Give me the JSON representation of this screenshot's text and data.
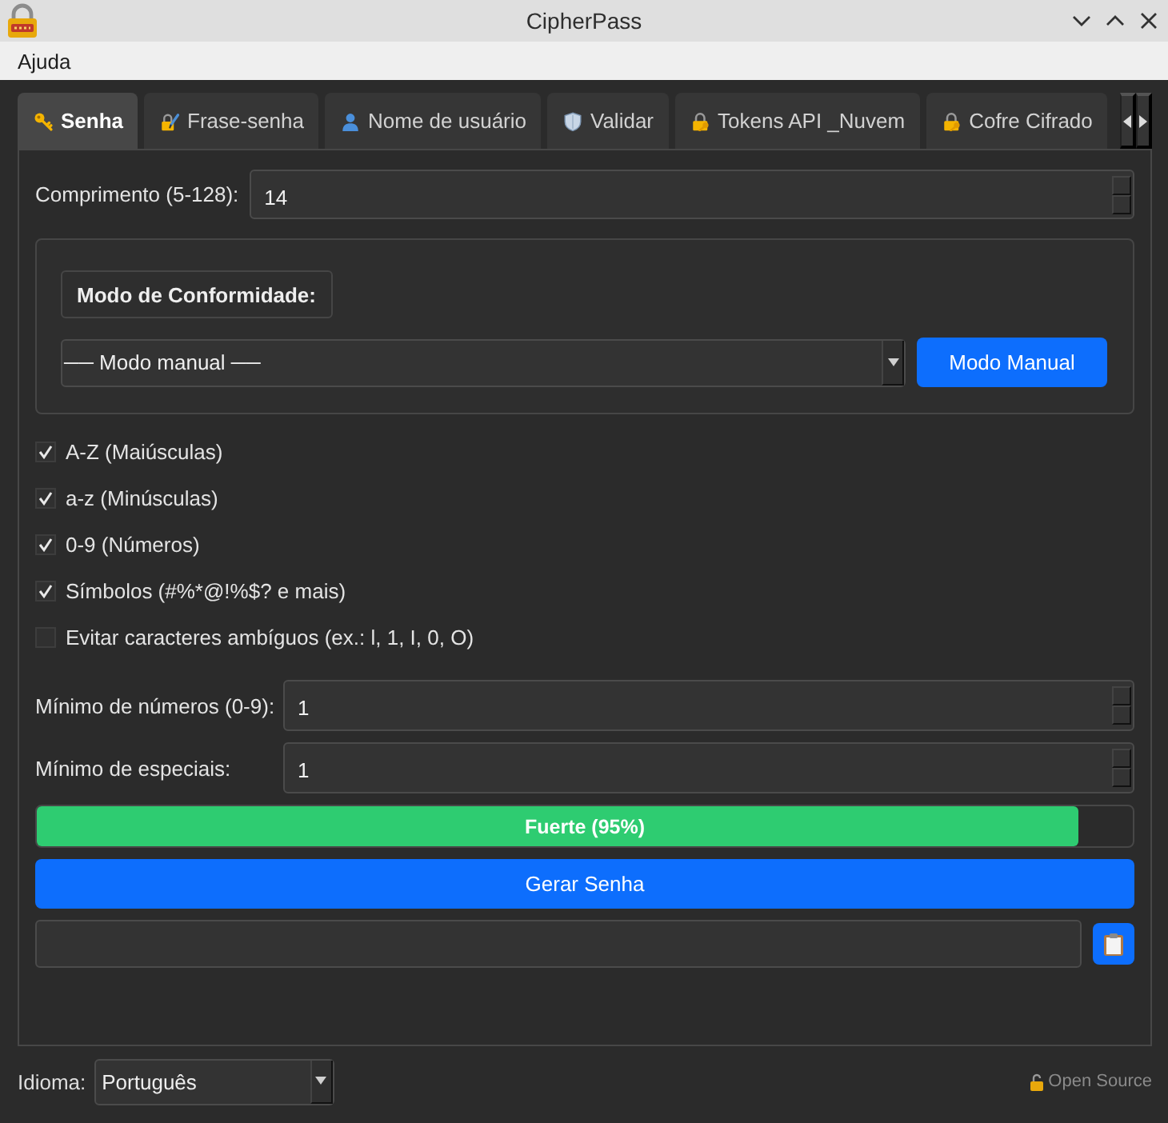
{
  "window": {
    "title": "CipherPass"
  },
  "menu": [
    "Ajuda"
  ],
  "tabs": [
    {
      "label": "Senha",
      "kind": "key",
      "selected": true
    },
    {
      "label": "Frase-senha",
      "kind": "lockpen",
      "selected": false
    },
    {
      "label": "Nome de usuário",
      "kind": "user",
      "selected": false
    },
    {
      "label": "Validar",
      "kind": "shield",
      "selected": false
    },
    {
      "label": "Tokens API _Nuvem",
      "kind": "lockkey",
      "selected": false
    },
    {
      "label": "Cofre Cifrado",
      "kind": "lockkey",
      "selected": false
    }
  ],
  "length": {
    "label": "Comprimento (5-128):",
    "value": "14"
  },
  "compliance": {
    "title": "Modo de Conformidade:",
    "mode": "── Modo manual ──",
    "button": "Modo Manual"
  },
  "options": [
    {
      "label": "A-Z (Maiúsculas)",
      "checked": true
    },
    {
      "label": "a-z (Minúsculas)",
      "checked": true
    },
    {
      "label": "0-9 (Números)",
      "checked": true
    },
    {
      "label": "Símbolos (#%*@!%$? e mais)",
      "checked": true
    },
    {
      "label": "Evitar caracteres ambíguos (ex.: l, 1, I, 0, O)",
      "checked": false
    }
  ],
  "minimums": [
    {
      "label": "Mínimo de números (0-9):",
      "value": "1"
    },
    {
      "label": "Mínimo de especiais:",
      "value": "1"
    }
  ],
  "strength": {
    "label": "Fuerte (95%)",
    "level": 0.95
  },
  "generate_button": "Gerar Senha",
  "footer": {
    "language_label": "Idioma:",
    "language": "Português",
    "note": "Open Source"
  }
}
